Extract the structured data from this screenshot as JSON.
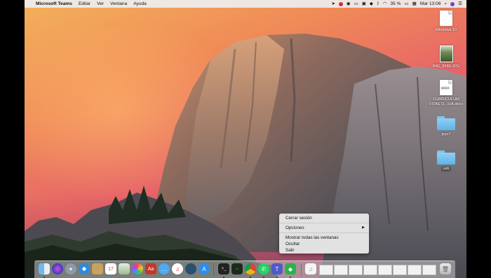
{
  "menubar": {
    "app_name": "Microsoft Teams",
    "menus": [
      "Editar",
      "Ver",
      "Ventana",
      "Ayuda"
    ],
    "battery": "35 %",
    "clock": "Mar 13:06"
  },
  "desktop_icons": [
    {
      "label": "Windows 10",
      "kind": "document"
    },
    {
      "label": "IMG_9586.JPG",
      "kind": "photo"
    },
    {
      "label": "CURRICULUM\nVITAE D...SIA.docx",
      "line1": "CURRICULUM",
      "line2": "VITAE D...SIA.docx",
      "badge": "DOCX",
      "kind": "docx"
    },
    {
      "label": "jeyc7",
      "kind": "folder"
    },
    {
      "label": "usb",
      "kind": "folder"
    }
  ],
  "context_menu": {
    "items": [
      "Cerrar sesión",
      "Opciones",
      "Mostrar todas las ventanas",
      "Ocultar",
      "Salir"
    ]
  },
  "dock": {
    "calendar_day": "17",
    "apps": [
      "finder-icon",
      "siri-icon",
      "launchpad-icon",
      "safari-icon",
      "notes-icon",
      "calendar-icon",
      "preview-icon",
      "photos-icon",
      "messages-icon",
      "facetime-icon",
      "itunes-icon",
      "app-store-icon",
      "terminal-icon",
      "activity-monitor-icon",
      "chrome-icon",
      "whatsapp-icon",
      "teams-icon",
      "feedly-icon"
    ]
  },
  "colors": {
    "sky_top": "#f3b25a",
    "sky_mid": "#e5606a",
    "folder_blue": "#5fb2e6",
    "menubar_bg": "#eeeeee"
  }
}
